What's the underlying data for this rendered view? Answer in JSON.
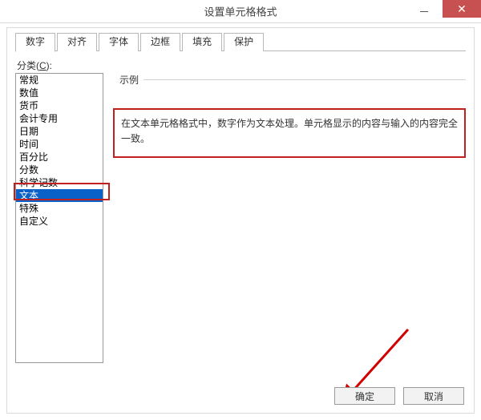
{
  "window": {
    "title": "设置单元格格式"
  },
  "title_controls": {
    "minimize_name": "minimize",
    "close_name": "close"
  },
  "tabs": [
    {
      "label": "数字",
      "active": true
    },
    {
      "label": "对齐"
    },
    {
      "label": "字体"
    },
    {
      "label": "边框"
    },
    {
      "label": "填充"
    },
    {
      "label": "保护"
    }
  ],
  "category": {
    "label_prefix": "分类(",
    "label_underline": "C",
    "label_suffix": "):",
    "items": [
      "常规",
      "数值",
      "货币",
      "会计专用",
      "日期",
      "时间",
      "百分比",
      "分数",
      "科学记数",
      "文本",
      "特殊",
      "自定义"
    ],
    "selected_index": 9
  },
  "example": {
    "label": "示例"
  },
  "description": "在文本单元格格式中，数字作为文本处理。单元格显示的内容与输入的内容完全一致。",
  "buttons": {
    "ok": "确定",
    "cancel": "取消"
  },
  "annotations": {
    "list_highlight": true,
    "desc_highlight": true,
    "arrow_to_ok": true
  }
}
